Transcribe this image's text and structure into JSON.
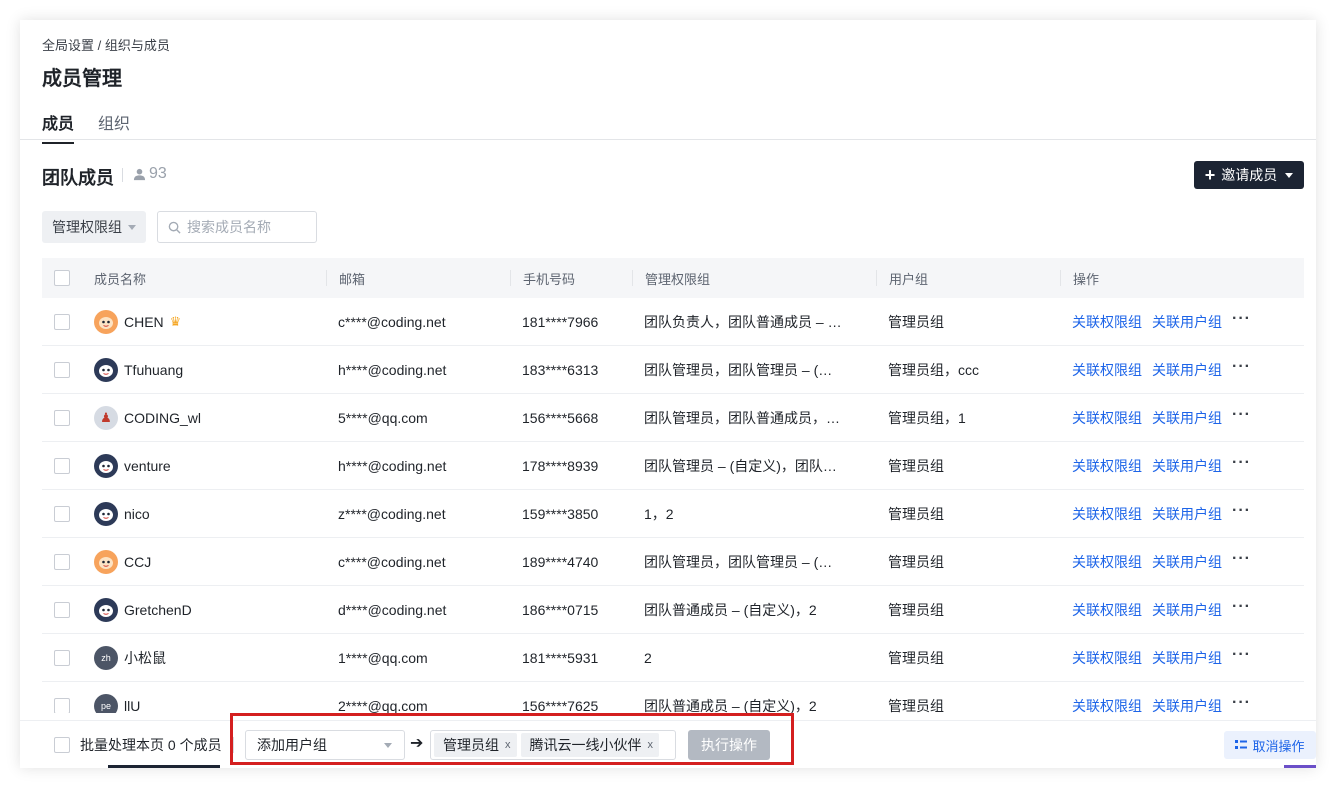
{
  "breadcrumb": "全局设置 / 组织与成员",
  "page_title": "成员管理",
  "tabs": [
    {
      "label": "成员",
      "active": true
    },
    {
      "label": "组织",
      "active": false
    }
  ],
  "section": {
    "title": "团队成员",
    "member_count": "93",
    "invite_button": "邀请成员"
  },
  "filters": {
    "permission_group_button": "管理权限组",
    "search_placeholder": "搜索成员名称"
  },
  "table": {
    "headers": {
      "name": "成员名称",
      "email": "邮箱",
      "phone": "手机号码",
      "permission_group": "管理权限组",
      "user_group": "用户组",
      "actions": "操作"
    },
    "action_labels": {
      "link_permission": "关联权限组",
      "link_user_group": "关联用户组"
    },
    "rows": [
      {
        "name": "CHEN",
        "email": "c****@coding.net",
        "phone": "181****7966",
        "permission_group": "团队负责人，团队普通成员 – …",
        "user_group": "管理员组",
        "avatar": "orange-face-avatar",
        "owner": true
      },
      {
        "name": "Tfuhuang",
        "email": "h****@coding.net",
        "phone": "183****6313",
        "permission_group": "团队管理员，团队管理员 – (…",
        "user_group": "管理员组，ccc",
        "avatar": "dark-face-avatar"
      },
      {
        "name": "CODING_wl",
        "email": "5****@qq.com",
        "phone": "156****5668",
        "permission_group": "团队管理员，团队普通成员，…",
        "user_group": "管理员组，1",
        "avatar": "photo-avatar"
      },
      {
        "name": "venture",
        "email": "h****@coding.net",
        "phone": "178****8939",
        "permission_group": "团队管理员 – (自定义)，团队…",
        "user_group": "管理员组",
        "avatar": "dark-face-avatar"
      },
      {
        "name": "nico",
        "email": "z****@coding.net",
        "phone": "159****3850",
        "permission_group": "1，2",
        "user_group": "管理员组",
        "avatar": "dark-face-avatar"
      },
      {
        "name": "CCJ",
        "email": "c****@coding.net",
        "phone": "189****4740",
        "permission_group": "团队管理员，团队管理员 – (…",
        "user_group": "管理员组",
        "avatar": "orange-face-avatar"
      },
      {
        "name": "GretchenD",
        "email": "d****@coding.net",
        "phone": "186****0715",
        "permission_group": "团队普通成员 – (自定义)，2",
        "user_group": "管理员组",
        "avatar": "dark-face-avatar"
      },
      {
        "name": "小松鼠",
        "email": "1****@qq.com",
        "phone": "181****5931",
        "permission_group": "2",
        "user_group": "管理员组",
        "avatar": "initials-avatar",
        "initials": "zh"
      },
      {
        "name": "llU",
        "email": "2****@qq.com",
        "phone": "156****7625",
        "permission_group": "团队普通成员 – (自定义)，2",
        "user_group": "管理员组",
        "avatar": "initials-avatar",
        "initials": "pe"
      }
    ]
  },
  "footer": {
    "batch_label": "批量处理本页 0 个成员",
    "action_select": "添加用户组",
    "selected_tags": [
      "管理员组",
      "腾讯云一线小伙伴"
    ],
    "execute_button": "执行操作",
    "cancel_button": "取消操作"
  },
  "colors": {
    "primary_dark": "#1c2433",
    "link_blue": "#1d64e8",
    "highlight_red": "#d41f1f",
    "disabled_gray": "#b3b9c2"
  }
}
